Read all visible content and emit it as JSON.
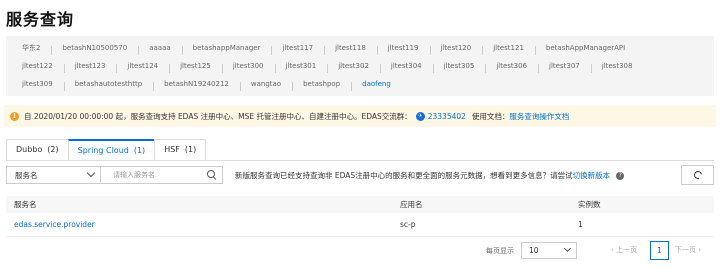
{
  "page": {
    "title": "服务查询"
  },
  "namespaces": {
    "row1": [
      "华东2",
      "betashN10500570",
      "aaaaa",
      "betashappManager",
      "jltest117",
      "jltest118",
      "jltest119",
      "jltest120",
      "jltest121",
      "betashAppManagerAPI"
    ],
    "row2": [
      "jltest122",
      "jltest123",
      "jltest124",
      "jltest125",
      "jltest300",
      "jltest301",
      "jltest302",
      "jltest304",
      "jltest305",
      "jltest306",
      "jltest307",
      "jltest308"
    ],
    "row3": [
      "jltest309",
      "betashautotesthttp",
      "betashN19240212",
      "wangtao",
      "betashpop",
      "daofeng"
    ],
    "active": "daofeng"
  },
  "notice": {
    "text": "自 2020/01/20 00:00:00 起，服务查询支持 EDAS 注册中心、MSE 托管注册中心、自建注册中心。EDAS交流群：",
    "group_number": "23335402",
    "doc_prefix": "使用文档：",
    "doc_link": "服务查询操作文档"
  },
  "tabs": [
    {
      "label": "Dubbo",
      "count": "(2)",
      "active": false
    },
    {
      "label": "Spring Cloud",
      "count": "(1)",
      "active": true
    },
    {
      "label": "HSF",
      "count": "(1)",
      "active": false
    }
  ],
  "filter": {
    "field_select": "服务名",
    "search_placeholder": "请输入服务名",
    "tip_text": "新版服务查询已经支持查询非 EDAS注册中心的服务和更全面的服务元数据，想看到更多信息？请尝试",
    "tip_link": "切换新版本"
  },
  "table": {
    "headers": {
      "service": "服务名",
      "app": "应用名",
      "instances": "实例数"
    },
    "rows": [
      {
        "service": "edas.service.provider",
        "app": "sc-p",
        "instances": "1"
      }
    ]
  },
  "pagination": {
    "page_size_label": "每页显示",
    "page_size": "10",
    "prev": "上一页",
    "next": "下一页",
    "current": "1"
  },
  "colors": {
    "accent": "#0070cc",
    "notice_bg": "#fff7e6",
    "warn": "#f0a020"
  }
}
